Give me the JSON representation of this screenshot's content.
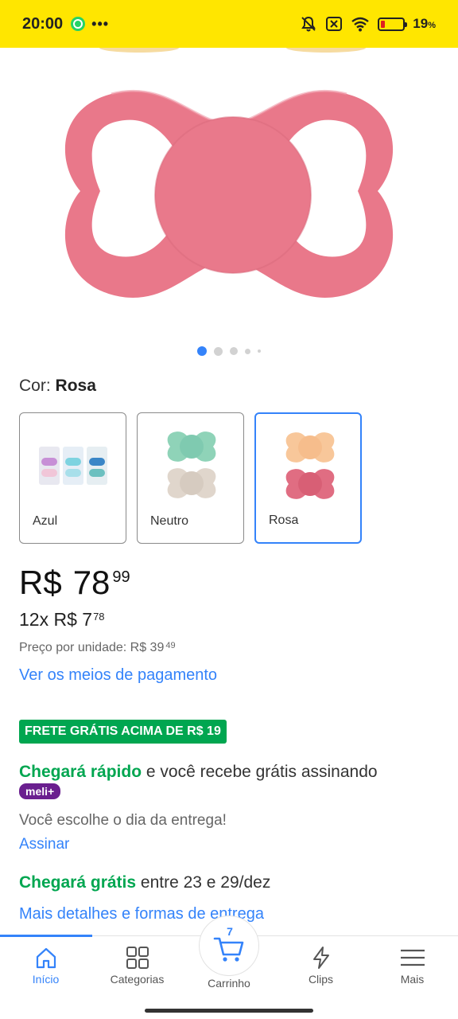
{
  "status_bar": {
    "time": "20:00",
    "more": "•••",
    "battery_percent_value": "19",
    "battery_percent_symbol": "%",
    "battery_level": 0.19,
    "icons": [
      "whatsapp-icon",
      "mute-icon",
      "sim-x-icon",
      "wifi-icon",
      "battery-icon"
    ]
  },
  "product": {
    "image_color": "#e9788a",
    "carousel": {
      "count": 5,
      "active_index": 0
    },
    "color_label": "Cor:",
    "color_selected": "Rosa",
    "variants": [
      {
        "label": "Azul",
        "selected": false
      },
      {
        "label": "Neutro",
        "selected": false
      },
      {
        "label": "Rosa",
        "selected": true
      }
    ]
  },
  "price": {
    "currency": "R$",
    "int": "78",
    "cents": "99",
    "installments_text": "12x R$ 7",
    "installments_cents": "78",
    "unit_price_text": "Preço por unidade: R$ 39",
    "unit_price_cents": "49",
    "payment_link": "Ver os meios de pagamento"
  },
  "shipping": {
    "free_badge": "FRETE GRÁTIS ACIMA DE R$ 19",
    "fast_highlight": "Chegará rápido",
    "fast_rest": " e você recebe grátis assinando",
    "meli_badge": "meli+",
    "choose_day": "Você escolhe o dia da entrega!",
    "subscribe_link": "Assinar",
    "free_highlight": "Chegará grátis",
    "free_rest": " entre 23 e 29/dez",
    "details_link": "Mais detalhes e formas de entrega"
  },
  "nav": {
    "items": [
      {
        "label": "Início",
        "icon": "home-icon",
        "active": true
      },
      {
        "label": "Categorias",
        "icon": "grid-icon",
        "active": false
      },
      {
        "label": "Carrinho",
        "icon": "cart-icon",
        "active": false
      },
      {
        "label": "Clips",
        "icon": "bolt-icon",
        "active": false
      },
      {
        "label": "Mais",
        "icon": "menu-icon",
        "active": false
      }
    ],
    "cart_count": "7"
  },
  "colors": {
    "status_bar": "#ffe600",
    "accent": "#3483fa",
    "green": "#00a650",
    "meli": "#6a1f8f"
  }
}
